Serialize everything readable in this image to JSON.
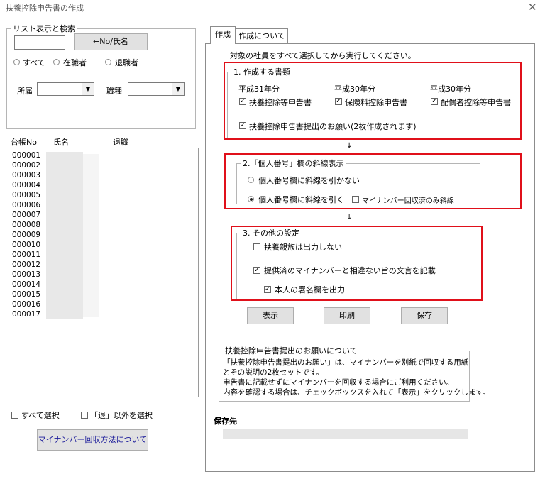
{
  "window": {
    "title": "扶養控除申告書の作成",
    "close_glyph": "✕"
  },
  "search": {
    "legend": "リスト表示と検索",
    "input_value": "",
    "no_button": "←No/氏名",
    "radio_all": "すべて",
    "radio_employed": "在職者",
    "radio_retired": "退職者",
    "dept_label": "所属",
    "job_label": "職種"
  },
  "list": {
    "headers": [
      "台帳No",
      "氏名",
      "退職"
    ],
    "rows": [
      "000001",
      "000002",
      "000003",
      "000004",
      "000005",
      "000006",
      "000007",
      "000008",
      "000009",
      "000010",
      "000011",
      "000012",
      "000013",
      "000014",
      "000015",
      "000016",
      "000017"
    ]
  },
  "bottom_left": {
    "select_all": "すべて選択",
    "select_not_retired": "「退」以外を選択",
    "mynumber_button": "マイナンバー回収方法について"
  },
  "tabs": [
    "作成",
    "作成について"
  ],
  "main": {
    "instruction": "対象の社員をすべて選択してから実行してください。",
    "doc_section": {
      "legend": "1. 作成する書類",
      "year1": "平成31年分",
      "year2": "平成30年分",
      "year3": "平成30年分",
      "cb1": "扶養控除等申告書",
      "cb2": "保険料控除申告書",
      "cb3": "配偶者控除等申告書",
      "cb4": "扶養控除申告書提出のお願い(2枚作成されます)"
    },
    "arrow": "↓",
    "number_section": {
      "legend": "2.「個人番号」欄の斜線表示",
      "radio1": "個人番号欄に斜線を引かない",
      "radio2": "個人番号欄に斜線を引く",
      "cb": "マイナンバー回収済のみ斜線"
    },
    "other_section": {
      "legend": "3. その他の設定",
      "cb1": "扶養親族は出力しない",
      "cb2": "提供済のマイナンバーと相違ない旨の文言を記載",
      "cb3": "本人の署名欄を出力"
    },
    "buttons": {
      "show": "表示",
      "print": "印刷",
      "save": "保存"
    },
    "info": {
      "legend": "扶養控除申告書提出のお願いについて",
      "lines": [
        "「扶養控除申告書提出のお願い」は、マイナンバーを別紙で回収する用紙",
        "とその説明の2枚セットです。",
        "申告書に記載せずにマイナンバーを回収する場合にご利用ください。",
        "内容を確認する場合は、チェックボックスを入れて「表示」をクリックします。"
      ]
    },
    "save_dest_label": "保存先"
  },
  "checks": {
    "mark": "✓"
  },
  "colors": {
    "highlight_box": "#e0101a",
    "button_face": "#e1e1e1"
  }
}
